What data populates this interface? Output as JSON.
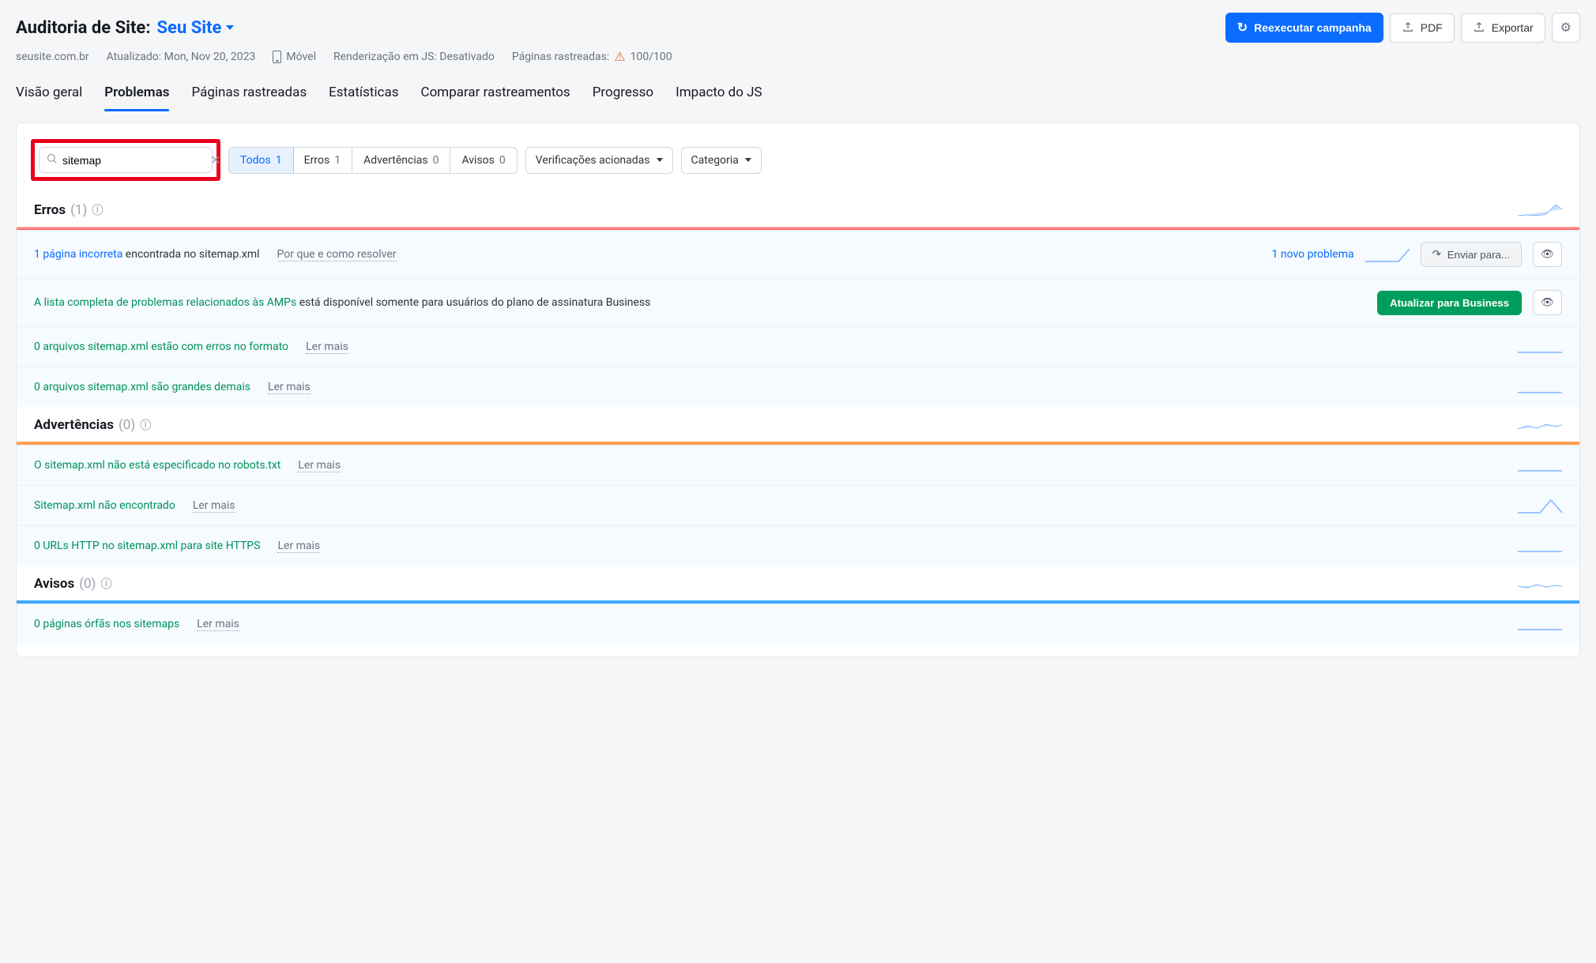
{
  "header": {
    "title_prefix": "Auditoria de Site:",
    "project_name": "Seu Site",
    "buttons": {
      "rerun": "Reexecutar campanha",
      "pdf": "PDF",
      "export": "Exportar"
    }
  },
  "subheader": {
    "domain": "seusite.com.br",
    "updated_label": "Atualizado: Mon, Nov 20, 2023",
    "device": "Móvel",
    "js_render": "Renderização em JS: Desativado",
    "crawled_label": "Páginas rastreadas:",
    "crawled_value": "100/100"
  },
  "tabs": {
    "overview": "Visão geral",
    "issues": "Problemas",
    "crawled": "Páginas rastreadas",
    "stats": "Estatísticas",
    "compare": "Comparar rastreamentos",
    "progress": "Progresso",
    "js_impact": "Impacto do JS"
  },
  "filters": {
    "search_value": "sitemap",
    "segments": {
      "all": "Todos",
      "all_count": "1",
      "errors": "Erros",
      "errors_count": "1",
      "warnings": "Advertências",
      "warnings_count": "0",
      "notices": "Avisos",
      "notices_count": "0"
    },
    "triggered": "Verificações acionadas",
    "category": "Categoria"
  },
  "sections": {
    "errors": {
      "title": "Erros",
      "count": "(1)",
      "rows": [
        {
          "link": "1 página incorreta",
          "rest": " encontrada no sitemap.xml",
          "more": "Por que e como resolver",
          "link_class": "link-blue",
          "new_problem": "1 novo problema",
          "send": "Enviar para..."
        },
        {
          "link": "A lista completa de problemas relacionados às AMPs",
          "rest": " está disponível somente para usuários do plano de assinatura Business",
          "link_class": "link-green",
          "upgrade": "Atualizar para Business"
        },
        {
          "link": "0 arquivos sitemap.xml estão com erros no formato",
          "more": "Ler mais",
          "link_class": "link-green"
        },
        {
          "link": "0 arquivos sitemap.xml são grandes demais",
          "more": "Ler mais",
          "link_class": "link-green"
        }
      ]
    },
    "warnings": {
      "title": "Advertências",
      "count": "(0)",
      "rows": [
        {
          "link": "O sitemap.xml não está especificado no robots.txt",
          "more": "Ler mais",
          "link_class": "link-green"
        },
        {
          "link": "Sitemap.xml não encontrado",
          "more": "Ler mais",
          "link_class": "link-green"
        },
        {
          "link": "0 URLs HTTP no sitemap.xml para site HTTPS",
          "more": "Ler mais",
          "link_class": "link-green"
        }
      ]
    },
    "notices": {
      "title": "Avisos",
      "count": "(0)",
      "rows": [
        {
          "link": "0 páginas órfãs nos sitemaps",
          "more": "Ler mais",
          "link_class": "link-green"
        }
      ]
    }
  }
}
